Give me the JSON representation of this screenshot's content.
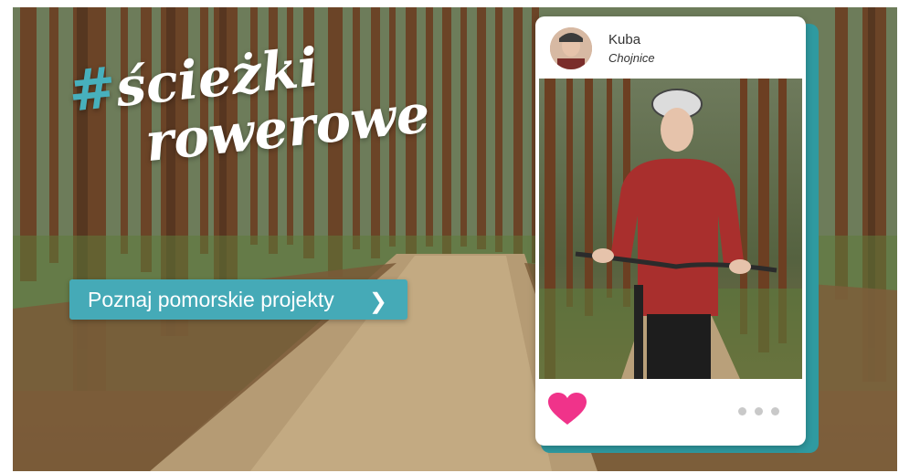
{
  "banner": {
    "hashtag_symbol": "#",
    "hashtag_word1": "ścieżki",
    "hashtag_word2": "rowerowe",
    "cta_label": "Poznaj pomorskie projekty",
    "cta_icon": "chevron-right-icon",
    "accent_color": "#45aab7"
  },
  "post": {
    "username": "Kuba",
    "location": "Chojnice",
    "like_icon": "heart-icon",
    "like_color": "#f0338a",
    "more_icon": "more-dots-icon"
  }
}
